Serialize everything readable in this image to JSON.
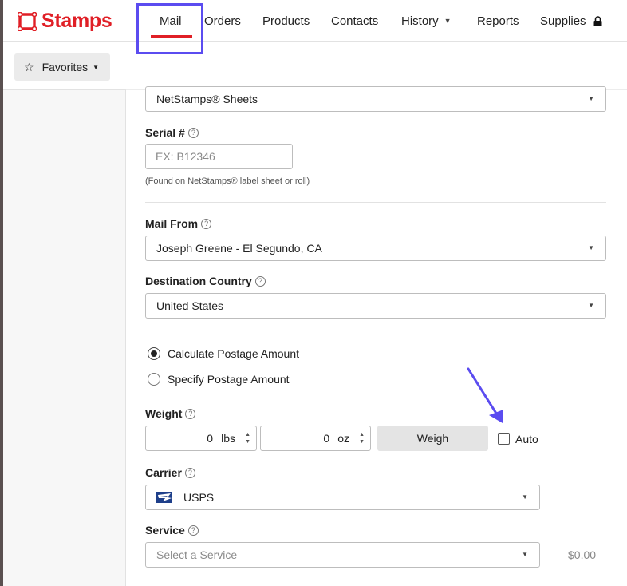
{
  "brand": {
    "name": "Stamps",
    "color": "#e01f26",
    "accent": "#5b4cf0"
  },
  "nav": {
    "mail": "Mail",
    "orders": "Orders",
    "products": "Products",
    "contacts": "Contacts",
    "history": "History",
    "reports": "Reports",
    "supplies": "Supplies"
  },
  "sidebar": {
    "favorites": "Favorites"
  },
  "form": {
    "print_on": {
      "value": "NetStamps® Sheets"
    },
    "serial": {
      "label": "Serial #",
      "placeholder": "EX: B12346",
      "hint": "(Found on NetStamps® label sheet or roll)"
    },
    "mail_from": {
      "label": "Mail From",
      "value": "Joseph Greene - El Segundo, CA"
    },
    "destination": {
      "label": "Destination Country",
      "value": "United States"
    },
    "postage_options": [
      {
        "label": "Calculate Postage Amount",
        "selected": true
      },
      {
        "label": "Specify Postage Amount",
        "selected": false
      }
    ],
    "weight": {
      "label": "Weight",
      "lbs_value": "0",
      "lbs_unit": "lbs",
      "oz_value": "0",
      "oz_unit": "oz",
      "weigh_button": "Weigh",
      "auto_label": "Auto",
      "auto_checked": false
    },
    "carrier": {
      "label": "Carrier",
      "value": "USPS"
    },
    "service": {
      "label": "Service",
      "placeholder": "Select a Service",
      "fee": "$0.00"
    }
  },
  "icons": [
    "stamp-logo-icon",
    "lock-icon",
    "star-icon",
    "help-icon",
    "usps-eagle-icon",
    "chevron-down-icon",
    "spinner-icon"
  ]
}
